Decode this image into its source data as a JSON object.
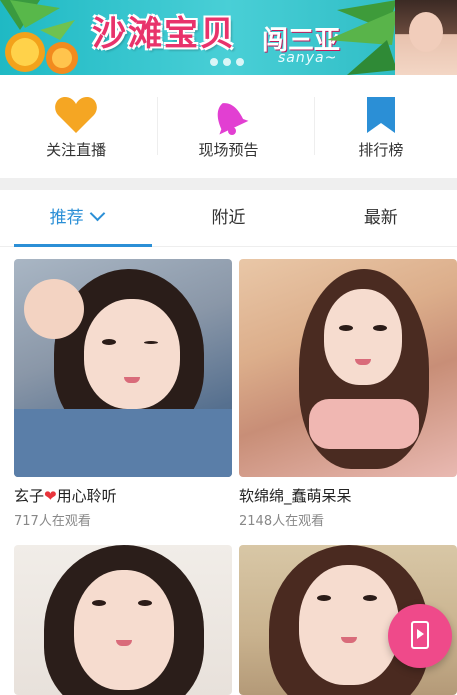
{
  "banner": {
    "title": "沙滩宝贝",
    "subtitle": "闯三亚",
    "tagline": "sanya~"
  },
  "quick_menu": [
    {
      "label": "关注直播",
      "icon": "heart-icon",
      "color": "#f5a623"
    },
    {
      "label": "现场预告",
      "icon": "bell-icon",
      "color": "#e23fd2"
    },
    {
      "label": "排行榜",
      "icon": "bookmark-icon",
      "color": "#2b8fd6"
    }
  ],
  "tabs": [
    {
      "label": "推荐",
      "active": true
    },
    {
      "label": "附近",
      "active": false
    },
    {
      "label": "最新",
      "active": false
    }
  ],
  "streams": [
    {
      "name_part1": "玄子",
      "name_part2": "用心聆听",
      "viewers": "717人在观看"
    },
    {
      "name": "软绵绵_蠢萌呆呆",
      "viewers": "2148人在观看"
    },
    {
      "name": "",
      "viewers": ""
    },
    {
      "name": "",
      "viewers": ""
    }
  ],
  "colors": {
    "accent": "#2b8fd6",
    "fab": "#ef4a8a"
  }
}
